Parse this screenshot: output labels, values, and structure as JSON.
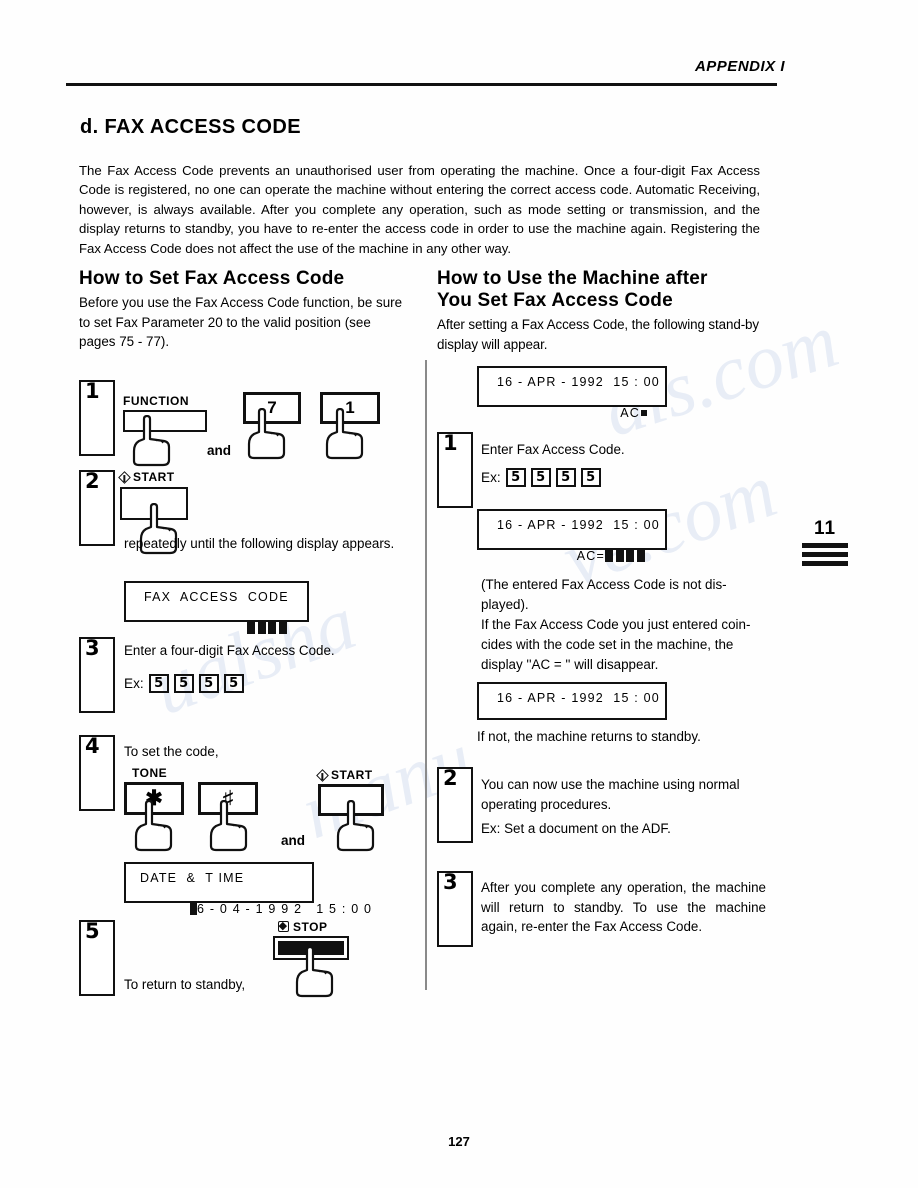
{
  "header": {
    "appendix": "APPENDIX I"
  },
  "section": {
    "title": "d.  FAX ACCESS CODE",
    "intro": "The Fax Access Code prevents an unauthorised user from operating the machine. Once a four-digit Fax Access Code is registered, no one can operate the machine without entering the correct access code. Automatic Receiving, however, is always available. After you complete any operation, such as mode setting or transmission, and the display returns to standby, you have to re-enter the access code in order to use the machine again. Registering the Fax Access Code does not affect the use of the machine in any other way."
  },
  "left_column": {
    "heading": "How to Set Fax Access Code",
    "lead": "Before you use the Fax Access Code function, be sure to set Fax Parameter 20 to the valid position (see pages 75 - 77).",
    "step1": {
      "number": "1",
      "function_key_label": "FUNCTION",
      "key_7": "7",
      "key_1": "1",
      "and": "and"
    },
    "step2": {
      "number": "2",
      "start_label": "START",
      "text": "repeatedly   until   the   following display  appears.",
      "lcd": {
        "line1": "FAX  ACCESS  CODE",
        "blocks": 4
      }
    },
    "step3": {
      "number": "3",
      "text": "Enter a four-digit Fax Access Code.",
      "ex_label": "Ex:",
      "ex_digits": [
        "5",
        "5",
        "5",
        "5"
      ]
    },
    "step4": {
      "number": "4",
      "text": "To set the code,",
      "tone_label": "TONE",
      "key_star": "✱",
      "key_hash": "♯",
      "start_label": "START",
      "and": "and",
      "lcd": {
        "line1": "DATE  &  T IME",
        "line2": "6 - 0 4 - 1 9 9 2   1 5 : 0 0"
      }
    },
    "step5": {
      "number": "5",
      "text": "To return to standby,",
      "stop_label": "STOP"
    }
  },
  "right_column": {
    "heading_line1": "How to Use the Machine after",
    "heading_line2": "You Set Fax Access Code",
    "lead": "After setting a Fax Access Code, the following stand-by display will appear.",
    "lcd1": {
      "line1": "16 - APR - 1992  15 : 00",
      "line2": "AC"
    },
    "step1": {
      "number": "1",
      "text": "Enter Fax Access Code.",
      "ex_label": "Ex:",
      "ex_digits": [
        "5",
        "5",
        "5",
        "5"
      ]
    },
    "lcd2": {
      "line1": "16 - APR - 1992  15 : 00",
      "line2": "AC=",
      "blocks": 4
    },
    "note": "(The entered Fax Access Code is not displayed).\nIf the Fax Access Code you just entered coincides with the code set in the machine, the display ''AC = '' will disappear.",
    "note_lines": [
      "(The  entered  Fax  Access  Code  is  not  dis-",
      "played).",
      "If the Fax Access Code you just entered coin-",
      "cides  with  the  code  set  in  the  machine,  the",
      "display ''AC = '' will disappear."
    ],
    "lcd3": {
      "line1": "16 - APR - 1992  15 : 00"
    },
    "after_lcd3": "If not, the machine returns to standby.",
    "step2": {
      "number": "2",
      "line1": "You can now use the machine using normal",
      "line2": "operating procedures.",
      "line3": "Ex:  Set a document on the ADF."
    },
    "step3": {
      "number": "3",
      "lines": [
        "After   complete   any   operation,   the",
        "machine  will  return  to  standby.  To  use  the",
        "machine  again,  re-enter  the  Fax  Access",
        "Code."
      ],
      "text": "After you complete any operation, the machine will return to standby. To use the machine again, re-enter the Fax Access Code."
    }
  },
  "chapter_tab": {
    "number": "11"
  },
  "footer": {
    "page_number": "127"
  },
  "colors": {
    "ink": "#111111",
    "paper": "#fefefe",
    "divider": "#8a8a8a"
  }
}
